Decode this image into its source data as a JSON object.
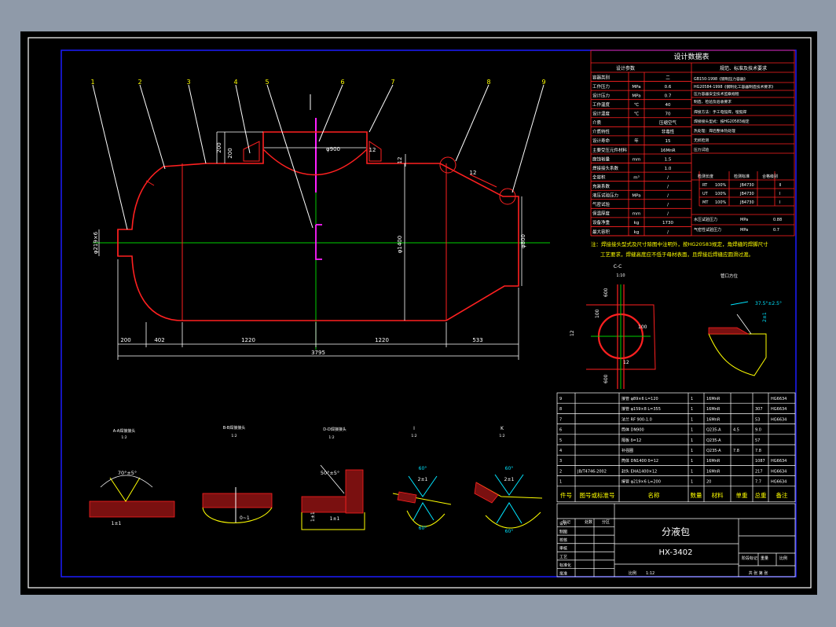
{
  "theme": {
    "background": "#8f9aa9",
    "canvas": "#000000",
    "frame": "#ffffff",
    "border_blue": "#1c1cff",
    "red": "#ff2020",
    "yellow": "#ffff00",
    "white": "#ffffff",
    "green": "#00d000",
    "cyan": "#00e5ff",
    "magenta": "#ff20ff"
  },
  "main_view": {
    "balloons": [
      "1",
      "2",
      "3",
      "4",
      "5",
      "6",
      "7",
      "8",
      "9"
    ],
    "dims": {
      "d200a": "200",
      "d402": "402",
      "d1220a": "1220",
      "d1220b": "1220",
      "d533": "533",
      "d3795": "3795",
      "d900": "φ900",
      "d1400": "φ1400",
      "d800": "φ800",
      "d12a": "12",
      "d12b": "12",
      "d12c": "12",
      "d200v": "200",
      "d200h": "200",
      "dnozzle": "φ219×6"
    }
  },
  "data_table": {
    "title": "设计数据表",
    "head_left": "设计参数",
    "head_right": "规范、标准及技术要求",
    "rows": [
      {
        "k": "容器类别",
        "u": "",
        "v": "二"
      },
      {
        "k": "工作压力",
        "u": "MPa",
        "v": "0.6"
      },
      {
        "k": "设计压力",
        "u": "MPa",
        "v": "0.7"
      },
      {
        "k": "工作温度",
        "u": "℃",
        "v": "40"
      },
      {
        "k": "设计温度",
        "u": "℃",
        "v": "70"
      },
      {
        "k": "介质",
        "u": "",
        "v": "压缩空气"
      },
      {
        "k": "介质特性",
        "u": "",
        "v": "非毒性"
      },
      {
        "k": "设计寿命",
        "u": "年",
        "v": "15"
      },
      {
        "k": "主要受压元件材料",
        "u": "",
        "v": "16MnR"
      },
      {
        "k": "腐蚀裕量",
        "u": "mm",
        "v": "1.5"
      },
      {
        "k": "焊接接头系数",
        "u": "",
        "v": "1.0"
      },
      {
        "k": "全容积",
        "u": "m³",
        "v": "/"
      },
      {
        "k": "充装系数",
        "u": "",
        "v": "/"
      },
      {
        "k": "液压试验压力",
        "u": "MPa",
        "v": "/"
      },
      {
        "k": "气密试验",
        "u": "",
        "v": "/"
      },
      {
        "k": "保温厚度",
        "u": "mm",
        "v": "/"
      },
      {
        "k": "设备净重",
        "u": "kg",
        "v": "1730"
      },
      {
        "k": "最大容积",
        "u": "kg",
        "v": "/"
      }
    ],
    "spec_lines": [
      "GB150-1998《钢制压力容器》",
      "HG20584-1998《钢制化工容器制造技术要求》",
      "压力容器安全技术监察规程",
      "制造、检验及验收要求",
      "焊接方法：手工电弧焊，埋弧焊",
      "焊接接头型式：按HG20583规定",
      "热处理：焊后整体热处理",
      "无损检测",
      "压力试验",
      "水压试验压力",
      "气密性试验压力"
    ],
    "ndt_headers": [
      "检测长度",
      "检测标准",
      "合格级别"
    ],
    "ndt_rows": [
      [
        "RT",
        "100%",
        "JB4730",
        "Ⅱ"
      ],
      [
        "UT",
        "100%",
        "JB4730",
        "Ⅰ"
      ],
      [
        "MT",
        "100%",
        "JB4730",
        "Ⅰ"
      ]
    ],
    "pressure_rows": [
      {
        "k": "水压试验压力",
        "u": "MPa",
        "v": "0.88"
      },
      {
        "k": "气密性试验压力",
        "u": "MPa",
        "v": "0.7"
      }
    ]
  },
  "notes": {
    "line1": "注：焊接接头型式及尺寸除图中注明外，按HG20583规定，角焊缝的焊脚尺寸",
    "line2": "工艺要求，焊缝高度应不低于母材表面，且焊接后焊缝应圆滑过渡。"
  },
  "details": {
    "c_title": "C-C",
    "c_scale": "1:10",
    "c_dims": {
      "a": "600",
      "b": "100",
      "c": "100",
      "d": "12",
      "e": "12",
      "f": "600"
    },
    "n_title": "管口方位",
    "n_dims": {
      "angle": "37.5°±2.5°",
      "h": "2±1"
    },
    "weld1": {
      "title": "A-A焊接接头",
      "scale": "1:2",
      "angle": "70°±5°",
      "gap": "1±1"
    },
    "weld2": {
      "title": "B-B焊接接头",
      "scale": "1:2",
      "gap": "0~1"
    },
    "weld3": {
      "title": "D-D焊接接头",
      "scale": "1:2",
      "angle": "50°±5°",
      "gap": "1±1",
      "h": "1±1"
    },
    "weld4": {
      "title": "I",
      "scale": "1:2",
      "angle": "60°",
      "gap": "2±1",
      "angle2": "60°"
    },
    "weld5": {
      "title": "K",
      "scale": "1:2",
      "angle": "60°",
      "gap": "2±1",
      "angle2": "60°"
    }
  },
  "bom": {
    "headers": [
      "件号",
      "图号或标准号",
      "名称",
      "数量",
      "材料",
      "单重",
      "总重",
      "备注"
    ],
    "rows": [
      [
        "9",
        "",
        "接管 φ89×6 L=120",
        "1",
        "16MnR",
        "",
        "",
        "HG6634"
      ],
      [
        "8",
        "",
        "接管 φ159×8 L=355",
        "1",
        "16MnR",
        "",
        "307",
        "HG6634"
      ],
      [
        "7",
        "",
        "法兰 RF 900-1.0",
        "1",
        "16MnR",
        "",
        "53",
        "HG6634"
      ],
      [
        "6",
        "",
        "筒体 DN900",
        "1",
        "Q235-A",
        "4.5",
        "9.0",
        ""
      ],
      [
        "5",
        "",
        "隔板 δ=12",
        "1",
        "Q235-A",
        "",
        "57",
        ""
      ],
      [
        "4",
        "",
        "补强圈",
        "1",
        "Q235-A",
        "7.8",
        "7.8",
        ""
      ],
      [
        "3",
        "",
        "筒体 DN1400 δ=12",
        "1",
        "16MnR",
        "",
        "1087",
        "HG6634"
      ],
      [
        "2",
        "JB/T4746-2002",
        "封头 EHA1400×12",
        "1",
        "16MnR",
        "",
        "217",
        "HG6634"
      ],
      [
        "1",
        "",
        "接管 φ219×6 L=200",
        "1",
        "20",
        "",
        "7.7",
        "HG6634"
      ]
    ]
  },
  "title_block": {
    "name": "分液包",
    "drawing_no": "HX-3402",
    "scale_label": "比例",
    "scale": "1:12",
    "left_labels": [
      "设计",
      "制图",
      "校核",
      "审核",
      "工艺",
      "标准化",
      "批准"
    ],
    "head_labels": [
      "标记",
      "处数",
      "分区",
      "更改文件号",
      "签名",
      "年月日"
    ],
    "right_labels": [
      "阶段标记",
      "重量",
      "比例"
    ],
    "sheet": "共  张  第  张"
  }
}
